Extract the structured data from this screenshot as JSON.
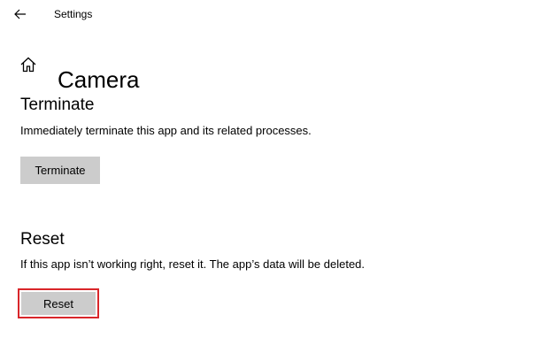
{
  "window": {
    "title": "Settings",
    "back_icon": "back-arrow-icon"
  },
  "header": {
    "home_icon": "home-icon",
    "title": "Camera"
  },
  "terminate": {
    "heading": "Terminate",
    "description": "Immediately terminate this app and its related processes.",
    "button_label": "Terminate"
  },
  "reset": {
    "heading": "Reset",
    "description": "If this app isn’t working right, reset it. The app’s data will be deleted.",
    "button_label": "Reset",
    "highlighted": true
  },
  "colors": {
    "button_bg": "#cccccc",
    "highlight": "#d9262a",
    "text": "#000000",
    "background": "#ffffff"
  }
}
